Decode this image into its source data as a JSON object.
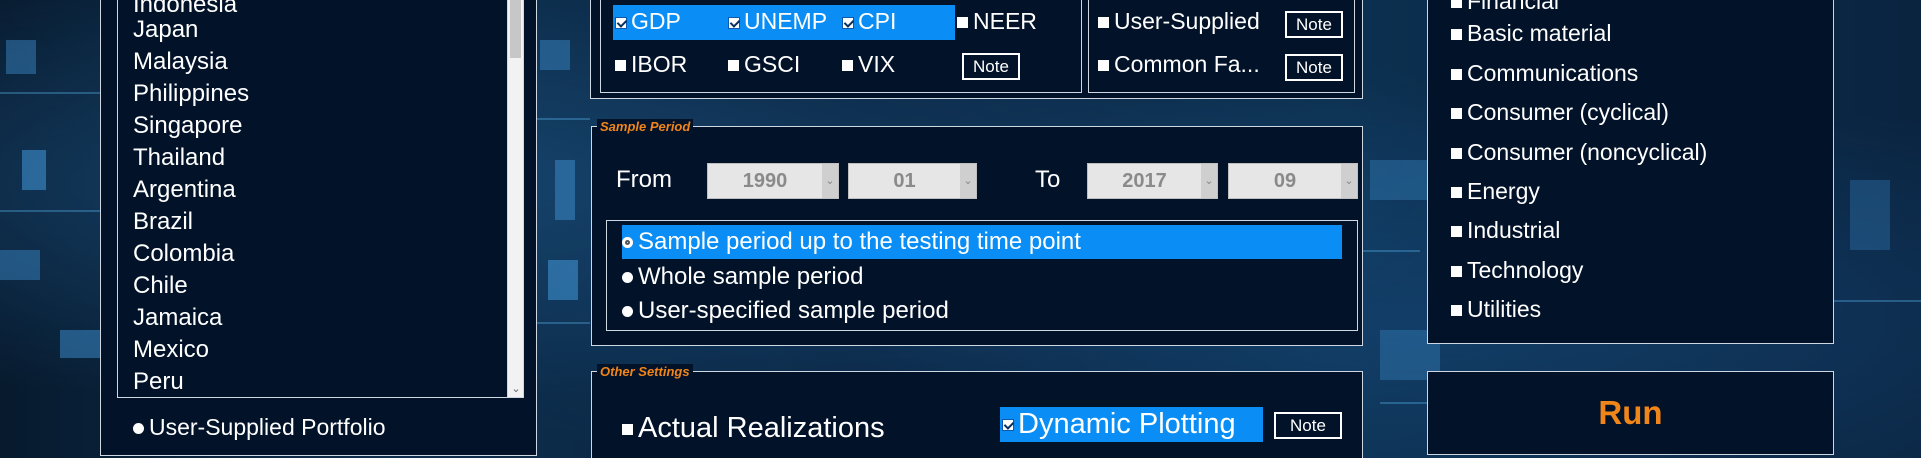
{
  "countries": {
    "items": [
      "Indonesia",
      "Japan",
      "Malaysia",
      "Philippines",
      "Singapore",
      "Thailand",
      "Argentina",
      "Brazil",
      "Colombia",
      "Chile",
      "Jamaica",
      "Mexico",
      "Peru"
    ],
    "user_portfolio_label": "User-Supplied Portfolio"
  },
  "variables": {
    "gdp": "GDP",
    "unemp": "UNEMP",
    "cpi": "CPI",
    "neer": "NEER",
    "ibor": "IBOR",
    "gsci": "GSCI",
    "vix": "VIX",
    "note": "Note"
  },
  "factors": {
    "user_supplied": "User-Supplied",
    "common": "Common Fa...",
    "note": "Note"
  },
  "sectors": {
    "items": [
      "Financial",
      "Basic material",
      "Communications",
      "Consumer (cyclical)",
      "Consumer (noncyclical)",
      "Energy",
      "Industrial",
      "Technology",
      "Utilities"
    ]
  },
  "sample_period": {
    "legend": "Sample Period",
    "from_label": "From",
    "to_label": "To",
    "from_year": "1990",
    "from_month": "01",
    "to_year": "2017",
    "to_month": "09",
    "options": [
      "Sample period up to the testing time point",
      "Whole sample period",
      "User-specified sample period"
    ]
  },
  "other_settings": {
    "legend": "Other Settings",
    "actual_realizations": "Actual Realizations",
    "dynamic_plotting": "Dynamic Plotting",
    "note": "Note"
  },
  "run": {
    "label": "Run"
  },
  "colors": {
    "accent": "#f0851a",
    "highlight": "#0a8ef5",
    "panel": "#021229"
  }
}
